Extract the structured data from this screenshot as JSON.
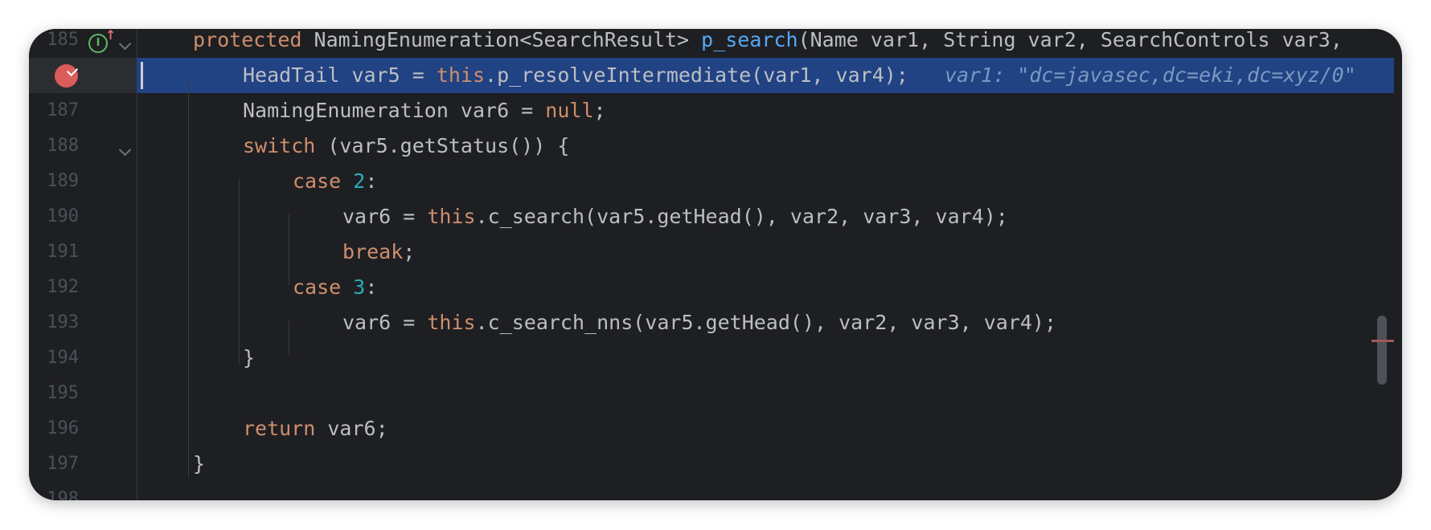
{
  "editor": {
    "lines": [
      {
        "num": "185",
        "tokens": [
          {
            "t": "protected ",
            "c": "kw"
          },
          {
            "t": "NamingEnumeration<SearchResult> ",
            "c": ""
          },
          {
            "t": "p_search",
            "c": "fn"
          },
          {
            "t": "(Name var1, String var2, SearchControls var3,",
            "c": ""
          }
        ]
      },
      {
        "num": "",
        "tokens": [
          {
            "t": "HeadTail var5 = ",
            "c": ""
          },
          {
            "t": "this",
            "c": "kw"
          },
          {
            "t": ".p_resolveIntermediate(var1, var4);",
            "c": ""
          },
          {
            "t": "   var1: \"dc=javasec,dc=eki,dc=xyz/0\"",
            "c": "inlay"
          }
        ]
      },
      {
        "num": "187",
        "tokens": [
          {
            "t": "NamingEnumeration var6 = ",
            "c": ""
          },
          {
            "t": "null",
            "c": "kw"
          },
          {
            "t": ";",
            "c": ""
          }
        ]
      },
      {
        "num": "188",
        "tokens": [
          {
            "t": "switch",
            "c": "kw"
          },
          {
            "t": " (var5.getStatus()) {",
            "c": ""
          }
        ]
      },
      {
        "num": "189",
        "tokens": [
          {
            "t": "case ",
            "c": "kw"
          },
          {
            "t": "2",
            "c": "num"
          },
          {
            "t": ":",
            "c": ""
          }
        ]
      },
      {
        "num": "190",
        "tokens": [
          {
            "t": "var6 = ",
            "c": ""
          },
          {
            "t": "this",
            "c": "kw"
          },
          {
            "t": ".c_search(var5.getHead(), var2, var3, var4);",
            "c": ""
          }
        ]
      },
      {
        "num": "191",
        "tokens": [
          {
            "t": "break",
            "c": "kw"
          },
          {
            "t": ";",
            "c": ""
          }
        ]
      },
      {
        "num": "192",
        "tokens": [
          {
            "t": "case ",
            "c": "kw"
          },
          {
            "t": "3",
            "c": "num"
          },
          {
            "t": ":",
            "c": ""
          }
        ]
      },
      {
        "num": "193",
        "tokens": [
          {
            "t": "var6 = ",
            "c": ""
          },
          {
            "t": "this",
            "c": "kw"
          },
          {
            "t": ".c_search_nns(var5.getHead(), var2, var3, var4);",
            "c": ""
          }
        ]
      },
      {
        "num": "194",
        "tokens": [
          {
            "t": "}",
            "c": ""
          }
        ]
      },
      {
        "num": "195",
        "tokens": []
      },
      {
        "num": "196",
        "tokens": [
          {
            "t": "return",
            "c": "kw"
          },
          {
            "t": " var6;",
            "c": ""
          }
        ]
      },
      {
        "num": "197",
        "tokens": [
          {
            "t": "}",
            "c": ""
          }
        ]
      },
      {
        "num": "198",
        "tokens": []
      }
    ]
  },
  "colors": {
    "background": "#1e1f22",
    "keyword": "#cf8e6d",
    "function": "#56a8f5",
    "number": "#2aacb8",
    "text": "#bcbec4",
    "highlight": "#214283",
    "breakpoint": "#db5c5c",
    "inlay_hint": "#7a9ac2"
  },
  "gutter_icons": {
    "line_185": [
      "implements-up-icon",
      "fold-icon"
    ],
    "line_186": [
      "breakpoint-verified-icon"
    ],
    "line_188": [
      "fold-icon"
    ]
  }
}
